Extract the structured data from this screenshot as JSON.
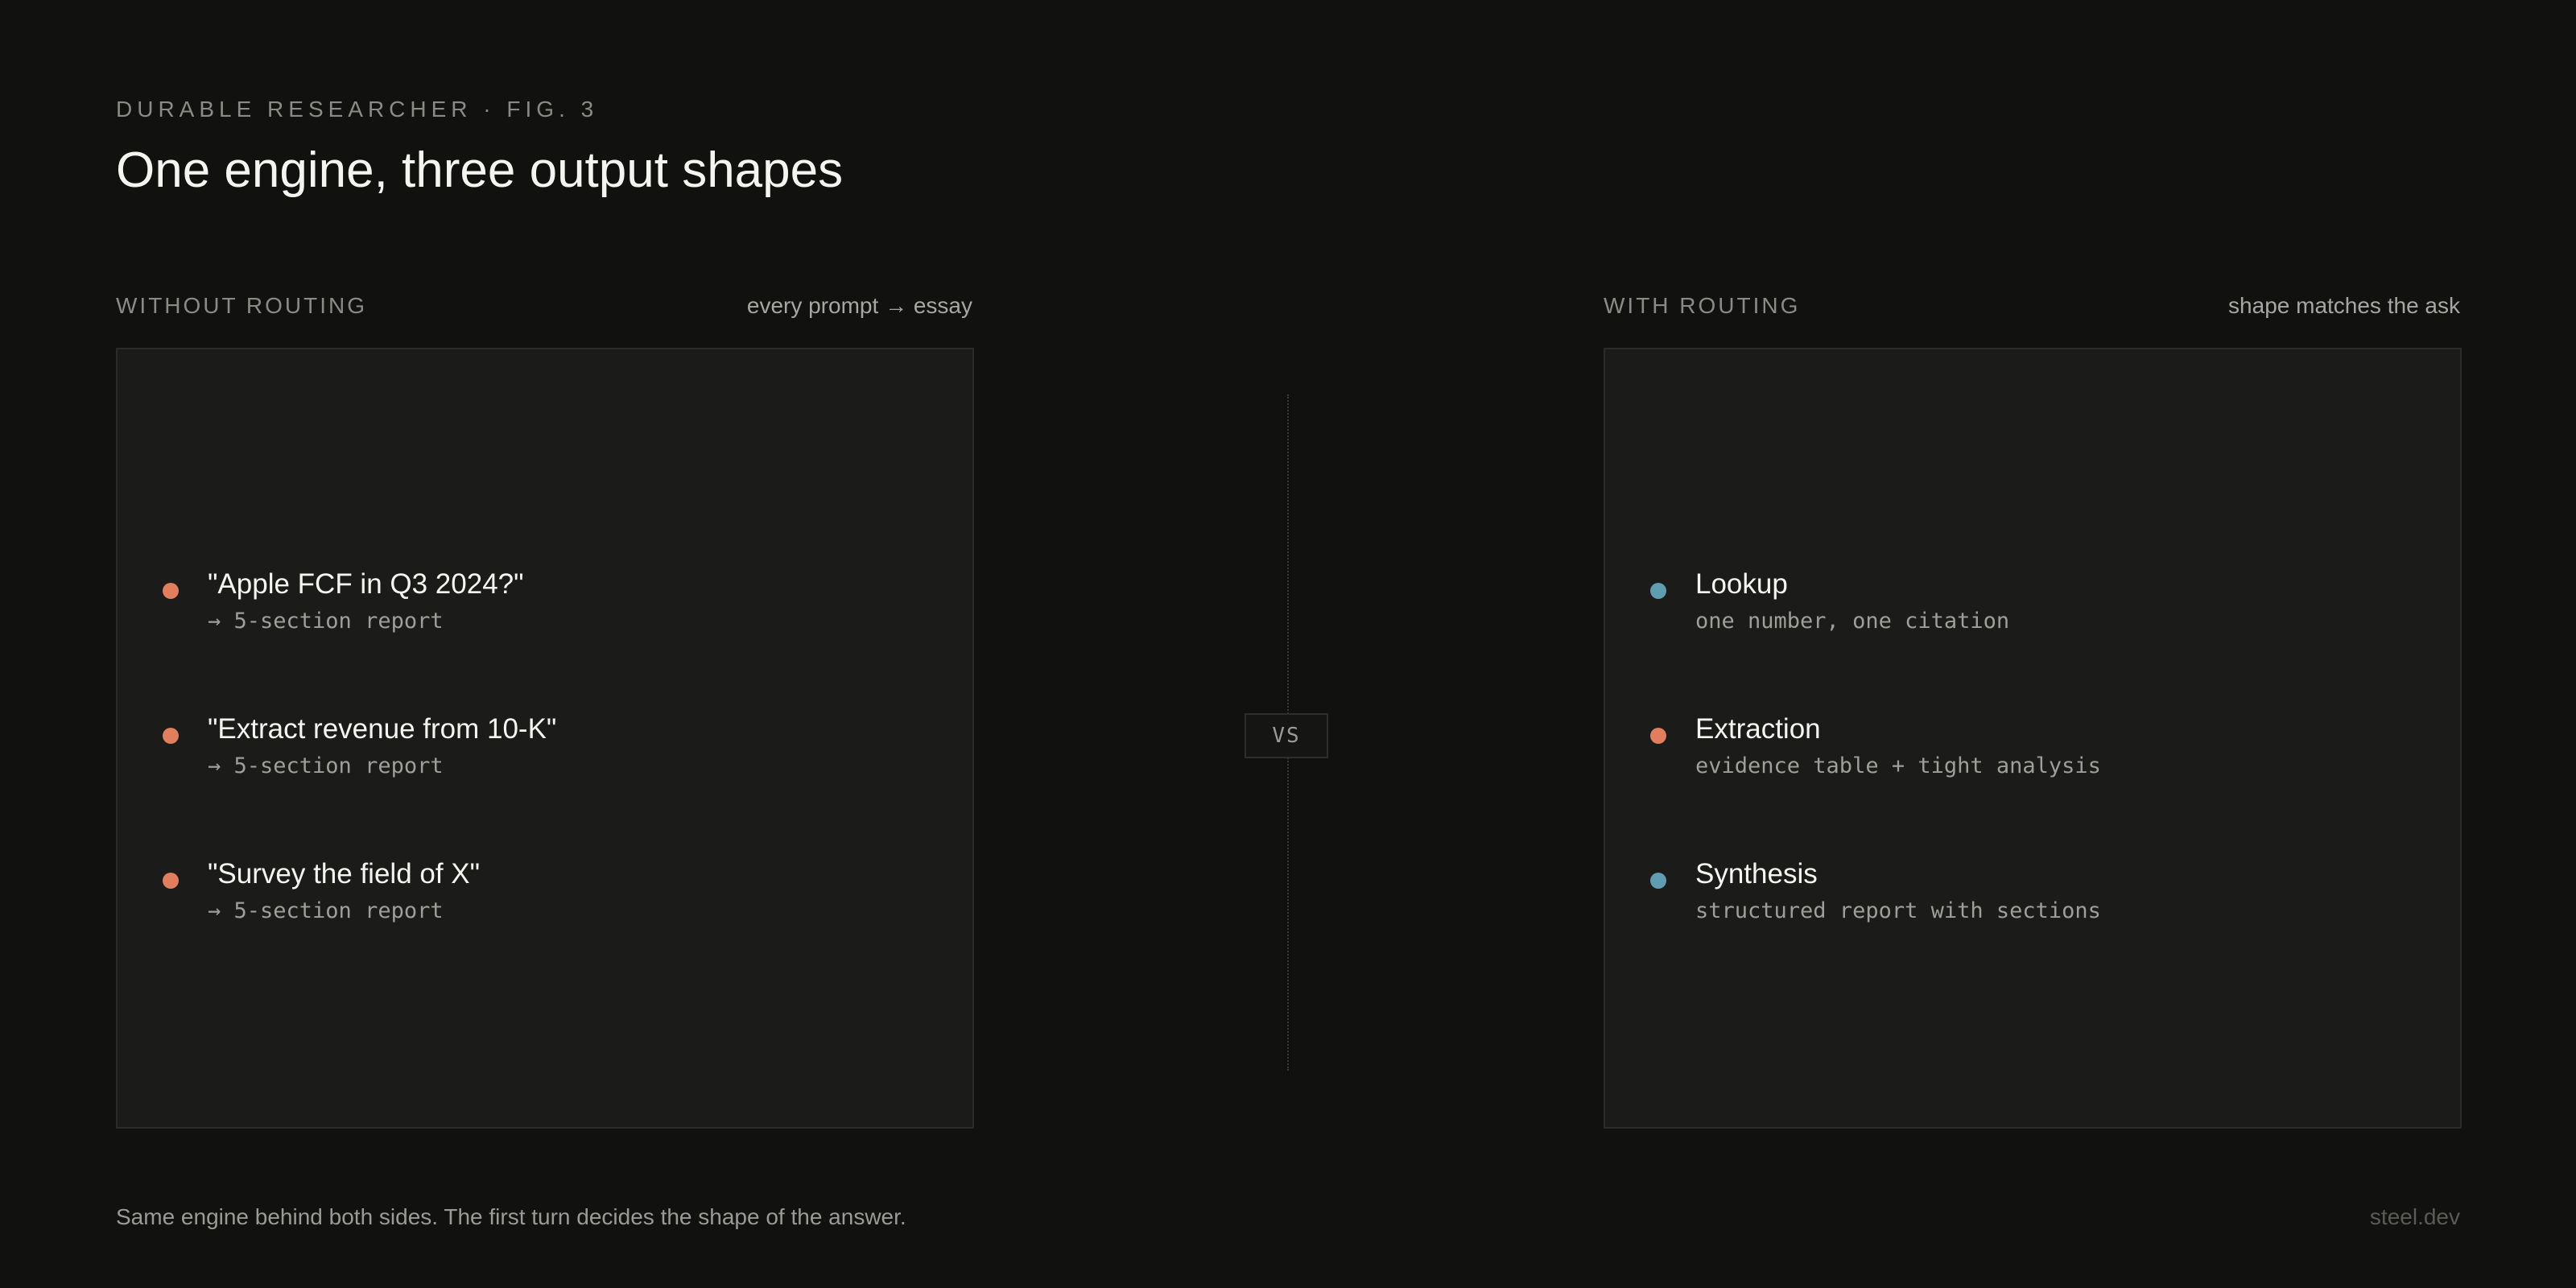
{
  "header": {
    "eyebrow": "DURABLE RESEARCHER · FIG. 3",
    "title": "One engine, three output shapes"
  },
  "left_column": {
    "label": "WITHOUT ROUTING",
    "note": "every prompt → essay",
    "items": [
      {
        "title": "\"Apple FCF in Q3 2024?\"",
        "subtitle": "→ 5-section report",
        "dot_color": "#e07e5e"
      },
      {
        "title": "\"Extract revenue from 10-K\"",
        "subtitle": "→ 5-section report",
        "dot_color": "#e07e5e"
      },
      {
        "title": "\"Survey the field of X\"",
        "subtitle": "→ 5-section report",
        "dot_color": "#e07e5e"
      }
    ]
  },
  "divider": {
    "label": "VS"
  },
  "right_column": {
    "label": "WITH ROUTING",
    "note": "shape matches the ask",
    "items": [
      {
        "title": "Lookup",
        "subtitle": "one number, one citation",
        "dot_color": "#5f9db3"
      },
      {
        "title": "Extraction",
        "subtitle": "evidence table + tight analysis",
        "dot_color": "#e07e5e"
      },
      {
        "title": "Synthesis",
        "subtitle": "structured report with sections",
        "dot_color": "#5f9db3"
      }
    ]
  },
  "footer": {
    "caption": "Same engine behind both sides. The first turn decides the shape of the answer.",
    "brand": "steel.dev"
  },
  "colors": {
    "background": "#111110",
    "panel": "#1b1b1a",
    "accent_orange": "#e07e5e",
    "accent_blue": "#5f9db3"
  }
}
